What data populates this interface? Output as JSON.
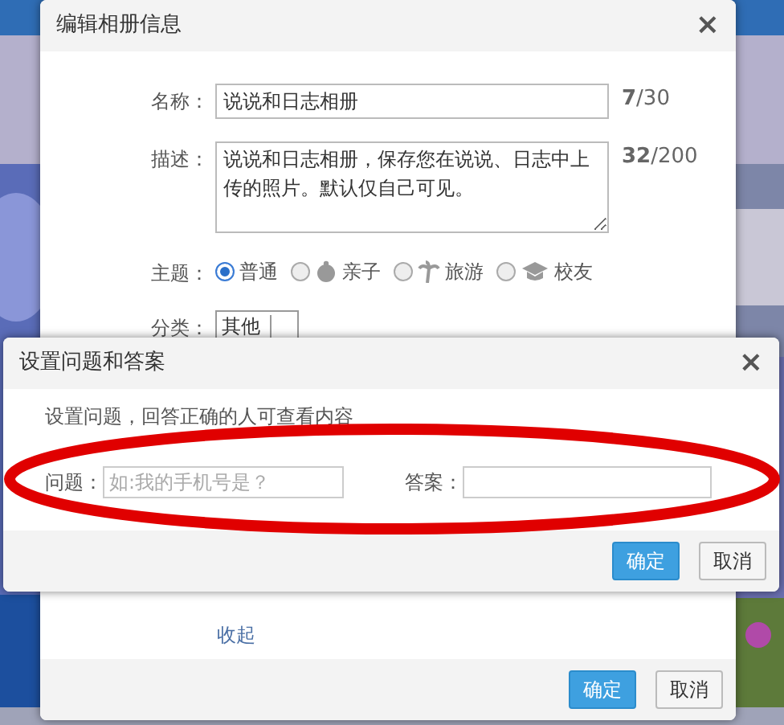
{
  "album_dialog": {
    "title": "编辑相册信息",
    "close": "×",
    "name": {
      "label": "名称：",
      "value": "说说和日志相册",
      "count": "**7**/30"
    },
    "description": {
      "label": "描述：",
      "value": "说说和日志相册，保存您在说说、日志中上传的照片。默认仅自己可见。",
      "count": "**32**/200"
    },
    "theme": {
      "label": "主题：",
      "options": [
        {
          "label": "普通",
          "selected": true
        },
        {
          "label": "亲子",
          "selected": false
        },
        {
          "label": "旅游",
          "selected": false
        },
        {
          "label": "校友",
          "selected": false
        }
      ]
    },
    "category": {
      "label": "分类：",
      "value": "其他"
    },
    "collapse_link": "收起",
    "buttons": [
      {
        "label": "确定",
        "kind": "primary"
      },
      {
        "label": "取消",
        "kind": "default"
      }
    ]
  },
  "question_dialog": {
    "title": "设置问题和答案",
    "close": "×",
    "hint": "设置问题，回答正确的人可查看内容",
    "question": {
      "label": "问题：",
      "placeholder": "如:我的手机号是？"
    },
    "answer": {
      "label": "答案："
    },
    "buttons": [
      {
        "label": "确定",
        "kind": "primary"
      },
      {
        "label": "取消",
        "kind": "default"
      }
    ]
  }
}
